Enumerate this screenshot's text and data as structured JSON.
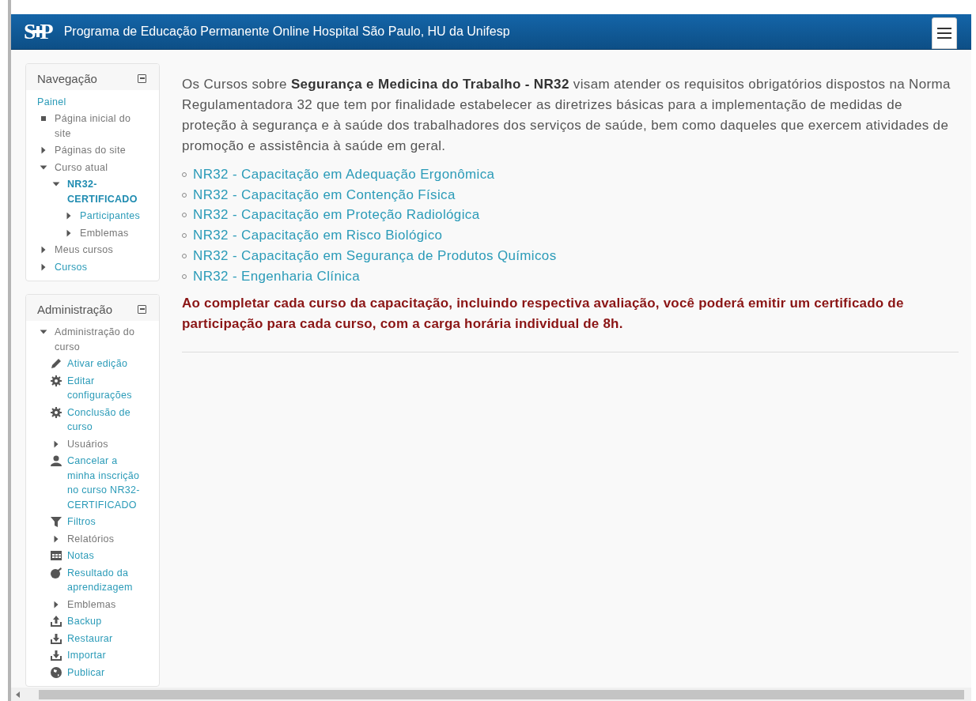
{
  "header": {
    "logo": "SP",
    "title": "Programa de Educação Permanente Online Hospital São Paulo, HU da Unifesp"
  },
  "navigation": {
    "title": "Navegação",
    "items": [
      {
        "label": "Painel",
        "kind": "plain",
        "link": true
      },
      {
        "label": "Página inicial do site",
        "kind": "bullet",
        "link": false
      },
      {
        "label": "Páginas do site",
        "kind": "node",
        "expanded": false,
        "link": false
      },
      {
        "label": "Curso atual",
        "kind": "node",
        "expanded": true,
        "link": false,
        "children": [
          {
            "label": "NR32-CERTIFICADO",
            "kind": "node",
            "expanded": true,
            "link": true,
            "current": true,
            "children": [
              {
                "label": "Participantes",
                "kind": "node",
                "expanded": false,
                "link": true
              },
              {
                "label": "Emblemas",
                "kind": "node",
                "expanded": false,
                "link": false
              }
            ]
          }
        ]
      },
      {
        "label": "Meus cursos",
        "kind": "node",
        "expanded": false,
        "link": false
      },
      {
        "label": "Cursos",
        "kind": "node",
        "expanded": false,
        "link": true
      }
    ]
  },
  "administration": {
    "title": "Administração",
    "items": [
      {
        "label": "Administração do curso",
        "kind": "node",
        "expanded": true,
        "link": false,
        "children": [
          {
            "label": "Ativar edição",
            "kind": "pencil",
            "link": true
          },
          {
            "label": "Editar configurações",
            "kind": "gear",
            "link": true
          },
          {
            "label": "Conclusão de curso",
            "kind": "gear",
            "link": true
          },
          {
            "label": "Usuários",
            "kind": "node",
            "expanded": false,
            "link": false
          },
          {
            "label": "Cancelar a minha inscrição no curso NR32-CERTIFICADO",
            "kind": "user",
            "link": true
          },
          {
            "label": "Filtros",
            "kind": "filter",
            "link": true
          },
          {
            "label": "Relatórios",
            "kind": "node",
            "expanded": false,
            "link": false
          },
          {
            "label": "Notas",
            "kind": "table",
            "link": true
          },
          {
            "label": "Resultado da aprendizagem",
            "kind": "target",
            "link": true
          },
          {
            "label": "Emblemas",
            "kind": "node",
            "expanded": false,
            "link": false
          },
          {
            "label": "Backup",
            "kind": "upload",
            "link": true
          },
          {
            "label": "Restaurar",
            "kind": "download",
            "link": true
          },
          {
            "label": "Importar",
            "kind": "download",
            "link": true
          },
          {
            "label": "Publicar",
            "kind": "globe",
            "link": true
          }
        ]
      }
    ]
  },
  "content": {
    "intro": "Os Cursos sobre **Segurança e Medicina do Trabalho - NR32** visam atender os requisitos obrigatórios dispostos na Norma Regulamentadora 32 que tem por finalidade estabelecer as diretrizes básicas para a implementação de medidas de proteção à segurança e à saúde dos trabalhadores dos serviços de saúde, bem como daqueles que exercem atividades de promoção e assistência à saúde em geral.",
    "courses": [
      "NR32 - Capacitação em Adequação Ergonômica",
      "NR32 - Capacitação em Contenção Física",
      "NR32 - Capacitação em Proteção Radiológica",
      "NR32 - Capacitação em Risco Biológico",
      "NR32 - Capacitação em Segurança de Produtos Químicos",
      "NR32 - Engenharia Clínica"
    ],
    "notice": "Ao completar cada curso da capacitação, incluindo respectiva avaliação, você poderá emitir um certificado de participação para cada curso, com a carga horária individual de 8h."
  }
}
